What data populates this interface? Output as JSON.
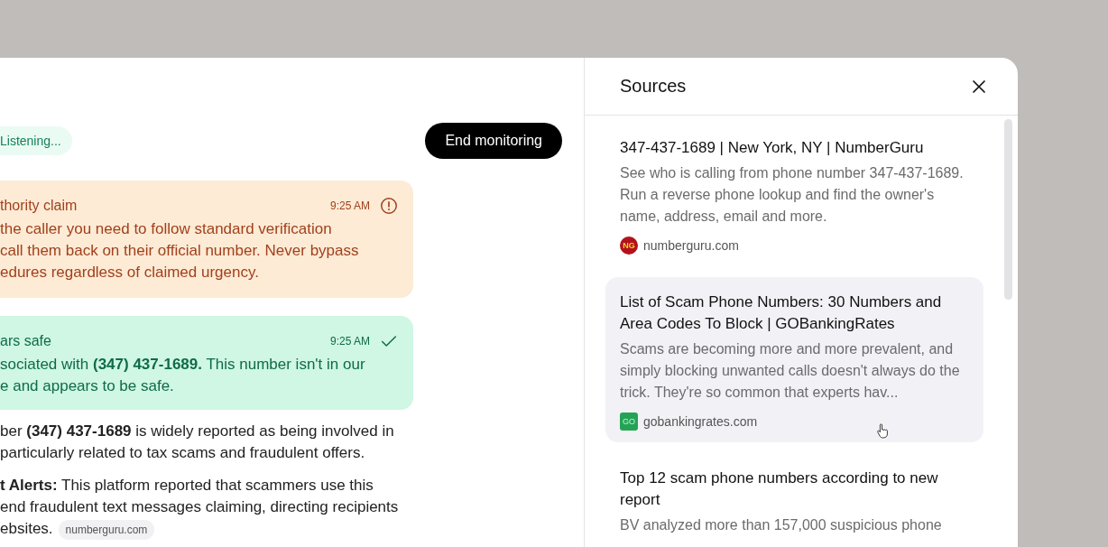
{
  "monitor": {
    "status": "Listening...",
    "end_button": "End monitoring"
  },
  "alerts": [
    {
      "kind": "warning",
      "title": "thority claim",
      "time": "9:25 AM",
      "lines": [
        "the caller you need to follow standard verification",
        "call them back on their official number. Never bypass",
        "edures regardless of claimed urgency."
      ]
    },
    {
      "kind": "safe",
      "title": "ars safe",
      "time": "9:25 AM",
      "lines": [
        "sociated with **(347) 437-1689.** This number isn't in our",
        "e and appears to be safe."
      ]
    }
  ],
  "paragraphs": [
    {
      "lines": [
        "ber **(347) 437-1689** is widely reported as being involved in",
        "particularly related to tax scams and fraudulent offers."
      ]
    },
    {
      "lines": [
        "**t Alerts:** This platform reported that scammers use this",
        "end fraudulent text messages claiming, directing recipients",
        "ebsites."
      ],
      "source_chip": "numberguru.com"
    }
  ],
  "sources_panel": {
    "title": "Sources",
    "items": [
      {
        "title": "347-437-1689 | New York, NY | NumberGuru",
        "description": "See who is calling from phone number 347-437-1689. Run a reverse phone lookup and find the owner's name, address, email and more.",
        "favicon_text": "NG",
        "kind": "circle",
        "color": "#b3121c",
        "domain": "numberguru.com",
        "selected": false
      },
      {
        "title": "List of Scam Phone Numbers: 30 Numbers and Area Codes To Block | GOBankingRates",
        "description": "Scams are becoming more and more prevalent, and simply blocking unwanted calls doesn't always do the trick. They're so common that experts hav...",
        "favicon_text": "GO",
        "kind": "square",
        "color": "#23a455",
        "domain": "gobankingrates.com",
        "selected": true
      },
      {
        "title": "Top 12 scam phone numbers according to new report",
        "description": "BV analyzed more than 157,000 suspicious phone",
        "selected": false
      }
    ]
  }
}
